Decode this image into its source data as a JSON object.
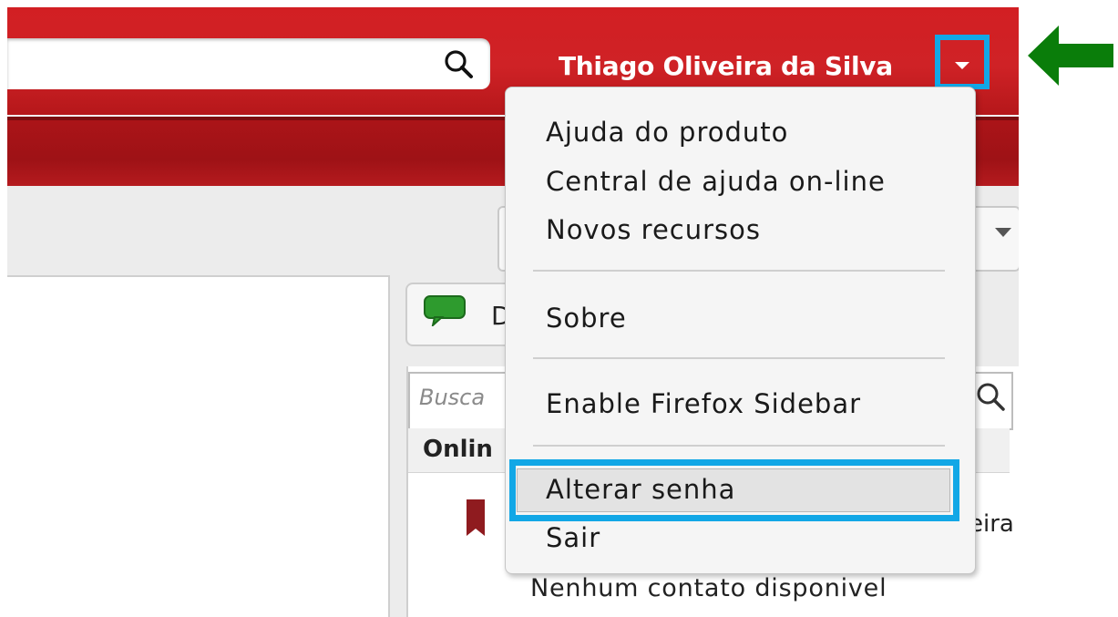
{
  "header": {
    "user_name": "Thiago Oliveira da Silva"
  },
  "content": {
    "chat_button_label": "D",
    "contact_search_placeholder": "Busca",
    "online_header": "Onlin",
    "contact_name_fragment": "eira",
    "no_contacts": "Nenhum contato disponivel"
  },
  "menu": {
    "items": [
      {
        "label": "Ajuda do produto"
      },
      {
        "label": "Central de ajuda on-line"
      },
      {
        "label": "Novos recursos"
      },
      {
        "label": "Sobre"
      },
      {
        "label": "Enable Firefox Sidebar"
      },
      {
        "label": "Alterar senha"
      },
      {
        "label": "Sair"
      }
    ]
  },
  "colors": {
    "brand_red": "#d21f23",
    "highlight_blue": "#12a7e6",
    "arrow_green": "#0a7d0a"
  },
  "icons": [
    "search-icon",
    "chevron-down-icon",
    "chat-bubble-icon",
    "bookmark-icon",
    "arrow-left-icon"
  ]
}
